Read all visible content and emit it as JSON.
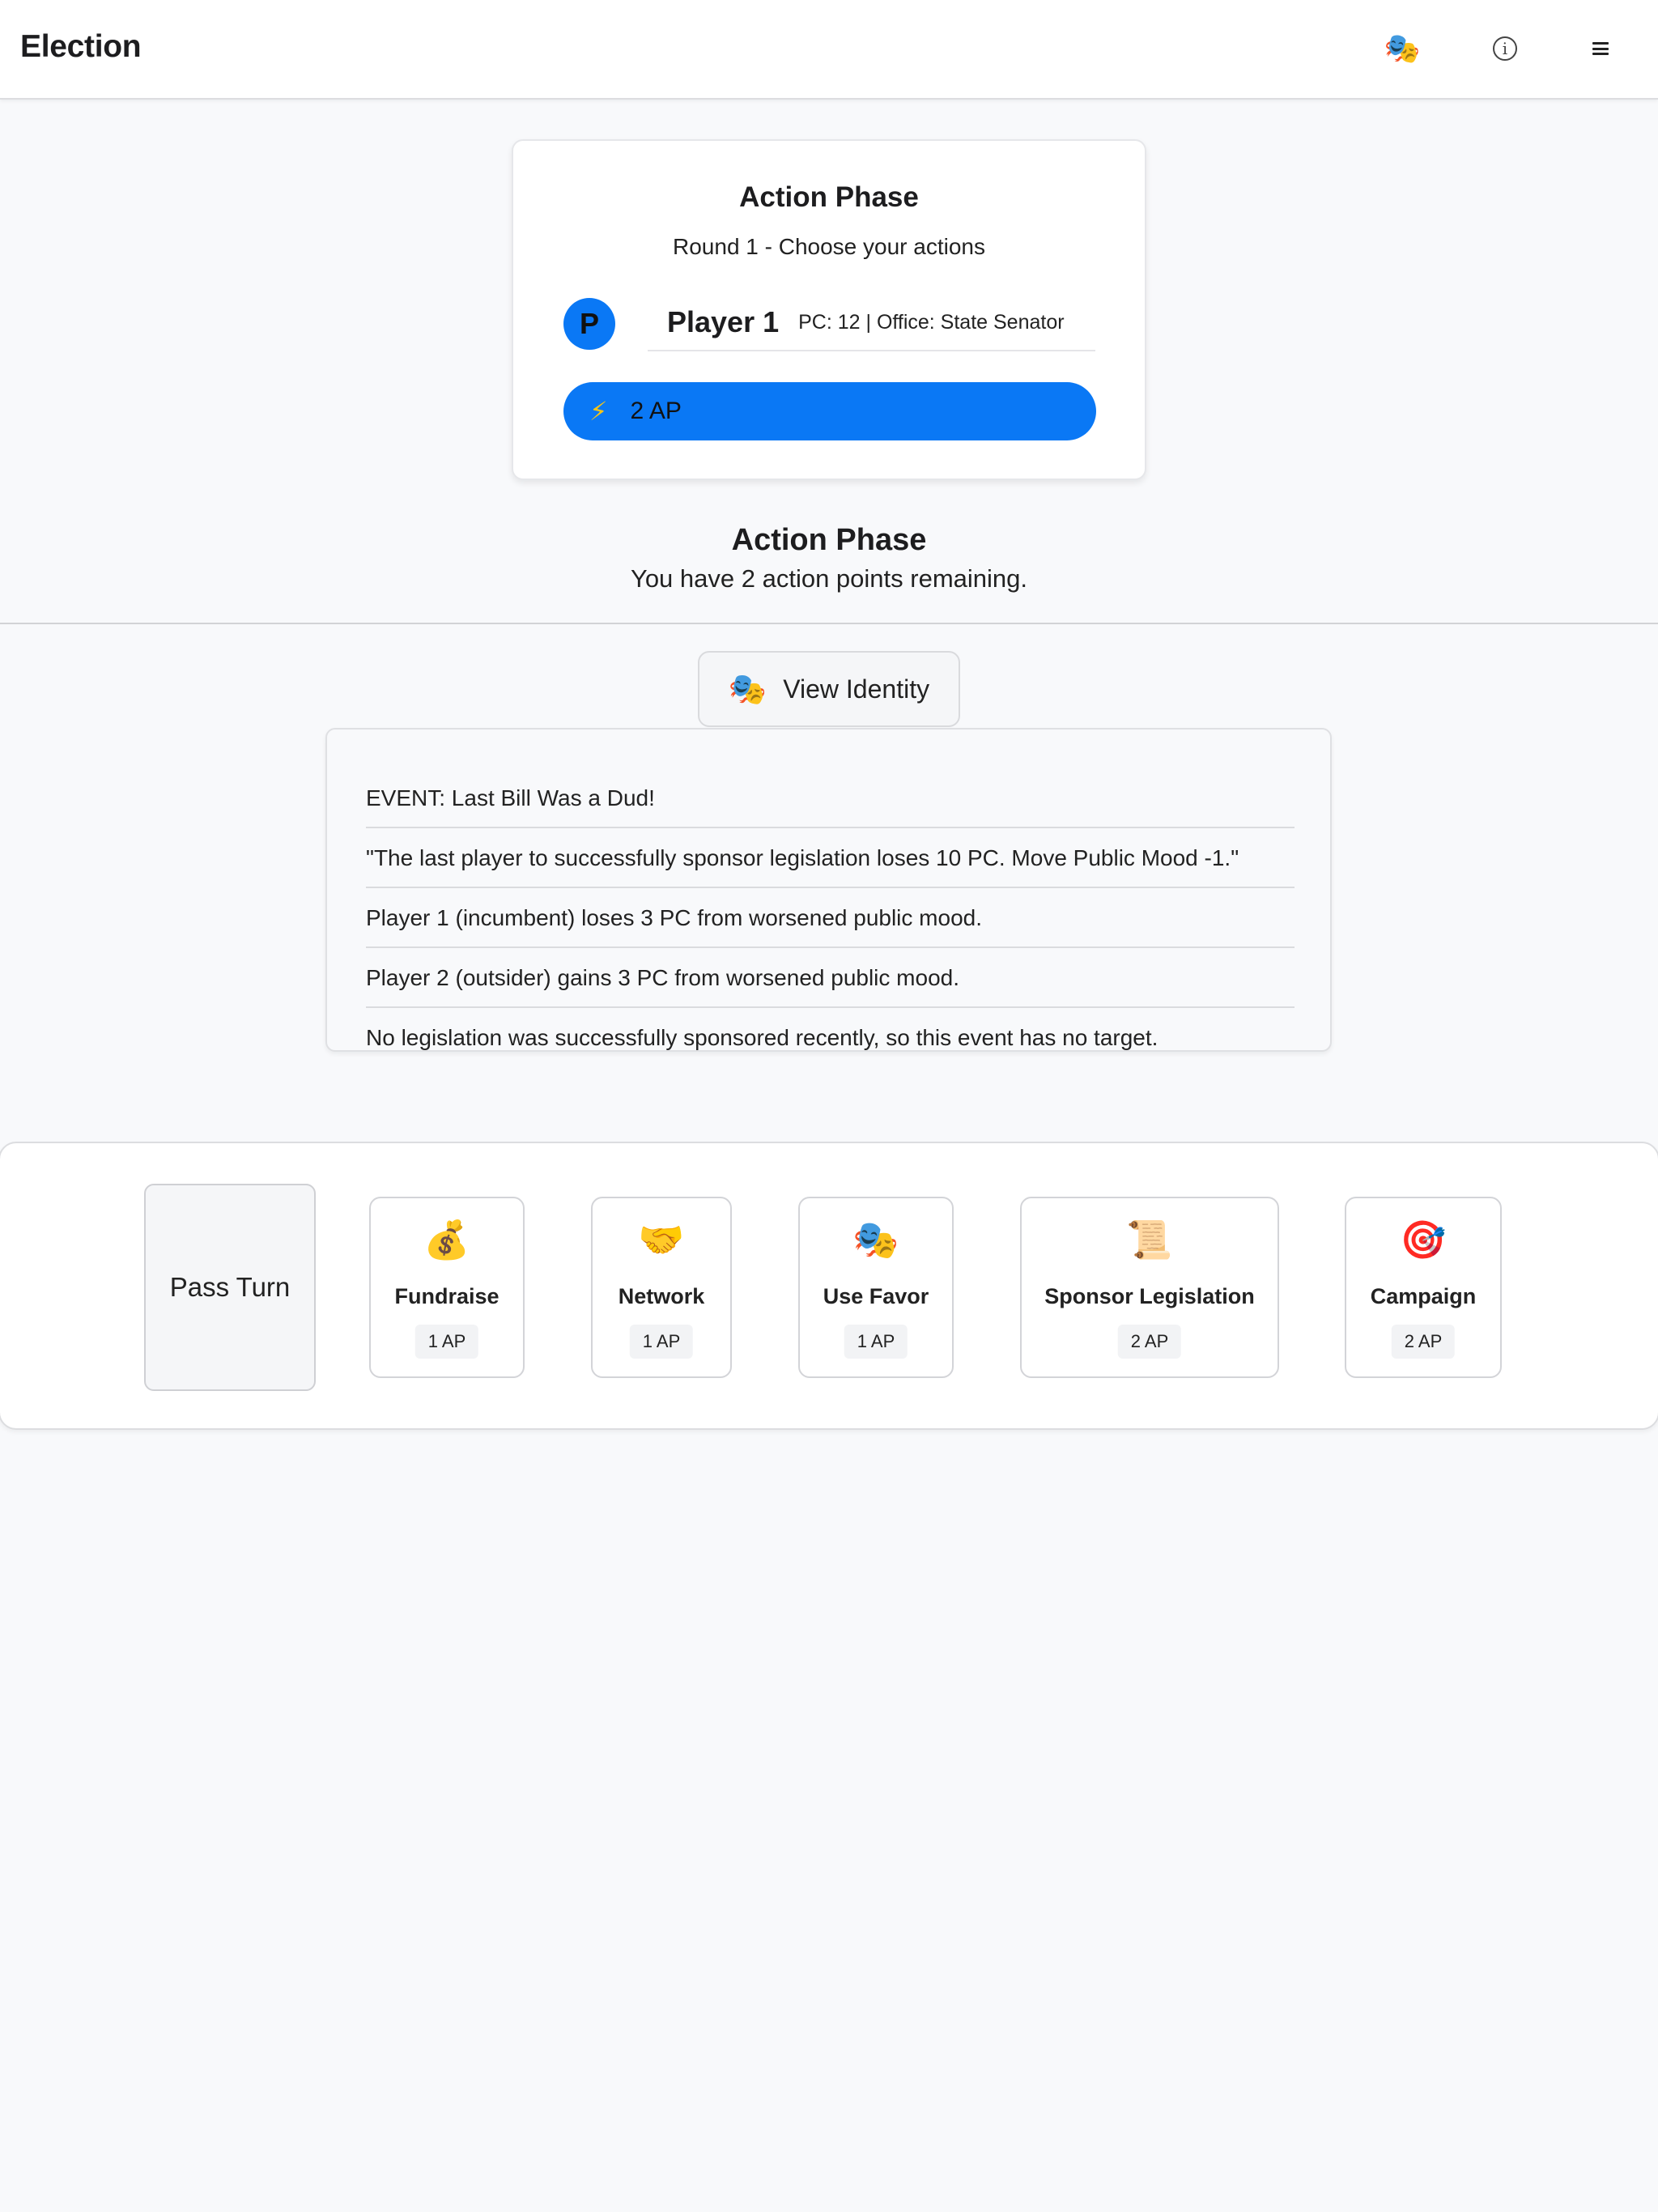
{
  "header": {
    "title": "Election",
    "mask_icon": "🎭",
    "info_icon": "i",
    "menu_icon": "menu"
  },
  "phase_card": {
    "title": "Action Phase",
    "subtitle": "Round 1 - Choose your actions",
    "avatar_letter": "P",
    "player_name": "Player 1",
    "player_meta": "PC: 12 | Office: State Senator",
    "ap_icon": "⚡",
    "ap_text": "2 AP"
  },
  "info": {
    "title": "Action Phase",
    "subtitle": "You have 2 action points remaining."
  },
  "identity_button": {
    "icon": "🎭",
    "label": "View Identity"
  },
  "event_log": [
    "EVENT: Last Bill Was a Dud!",
    "\"The last player to successfully sponsor legislation loses 10 PC. Move Public Mood -1.\"",
    "Player 1 (incumbent) loses 3 PC from worsened public mood.",
    "Player 2 (outsider) gains 3 PC from worsened public mood.",
    "No legislation was successfully sponsored recently, so this event has no target."
  ],
  "actions": {
    "pass_label": "Pass Turn",
    "items": [
      {
        "icon": "💰",
        "name": "Fundraise",
        "cost": "1 AP"
      },
      {
        "icon": "🤝",
        "name": "Network",
        "cost": "1 AP"
      },
      {
        "icon": "🎭",
        "name": "Use Favor",
        "cost": "1 AP"
      },
      {
        "icon": "📜",
        "name": "Sponsor Legislation",
        "cost": "2 AP"
      },
      {
        "icon": "🎯",
        "name": "Campaign",
        "cost": "2 AP"
      }
    ]
  },
  "colors": {
    "accent": "#0a78f5",
    "background": "#f8f9fb"
  }
}
